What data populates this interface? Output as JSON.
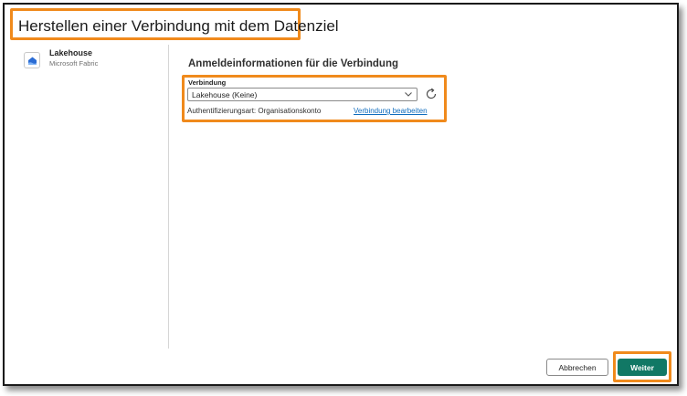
{
  "dialog": {
    "title": "Herstellen einer Verbindung mit dem Datenziel"
  },
  "left_pane": {
    "item": {
      "name": "Lakehouse",
      "subtitle": "Microsoft Fabric",
      "icon": "lakehouse-icon"
    }
  },
  "credentials": {
    "section_title": "Anmeldeinformationen für die Verbindung",
    "connection_label": "Verbindung",
    "connection_value": "Lakehouse (Keine)",
    "auth_text": "Authentifizierungsart: Organisationskonto",
    "edit_link": "Verbindung bearbeiten"
  },
  "footer": {
    "cancel_label": "Abbrechen",
    "next_label": "Weiter"
  },
  "colors": {
    "highlight": "#f08a1c",
    "primary": "#117865",
    "link": "#0f6cbd"
  }
}
